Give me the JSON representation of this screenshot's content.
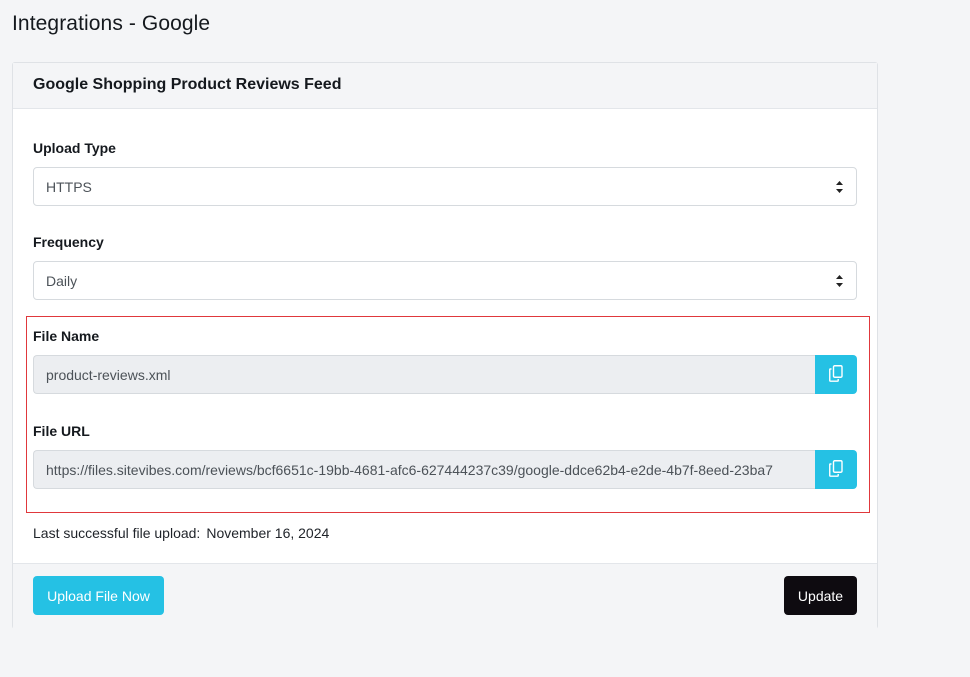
{
  "page": {
    "title": "Integrations - Google"
  },
  "card": {
    "title": "Google Shopping Product Reviews Feed",
    "upload_type": {
      "label": "Upload Type",
      "value": "HTTPS"
    },
    "frequency": {
      "label": "Frequency",
      "value": "Daily"
    },
    "file_name": {
      "label": "File Name",
      "value": "product-reviews.xml"
    },
    "file_url": {
      "label": "File URL",
      "value": "https://files.sitevibes.com/reviews/bcf6651c-19bb-4681-afc6-627444237c39/google-ddce62b4-e2de-4b7f-8eed-23ba7"
    },
    "last_upload": {
      "label": "Last successful file upload:",
      "date": "November 16, 2024"
    }
  },
  "footer": {
    "upload_now_label": "Upload File Now",
    "update_label": "Update"
  },
  "icons": {
    "copy": "copy-icon",
    "select_arrows": "sort-arrows-icon"
  },
  "colors": {
    "accent": "#25c1e4",
    "dark_button": "#0e0b10",
    "highlight_border": "#e0383c",
    "header_bg": "#f4f5f7"
  }
}
